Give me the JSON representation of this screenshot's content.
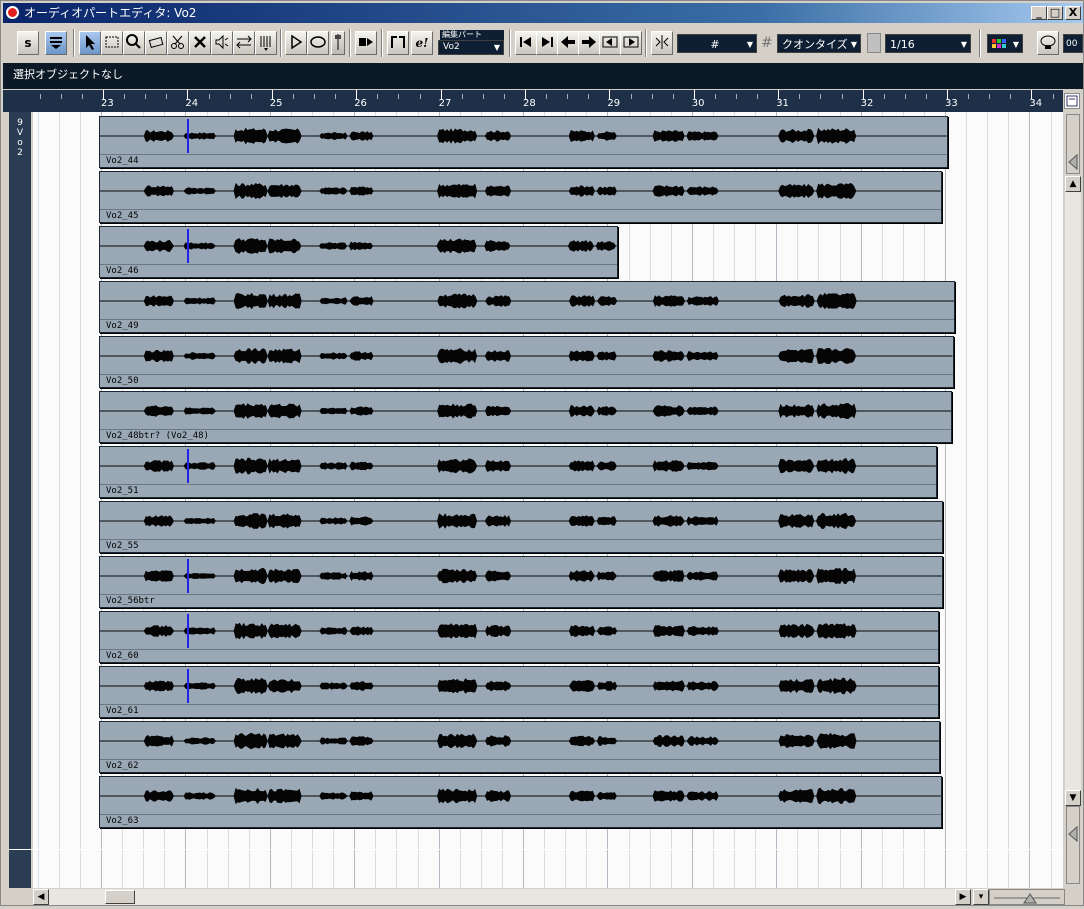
{
  "window": {
    "title": "オーディオパートエディタ: Vo2",
    "btn_min": "_",
    "btn_max": "□",
    "btn_close": "X"
  },
  "toolbar": {
    "solo": "s",
    "edit_part_label": "編集パート",
    "edit_part_value": "Vo2",
    "snap_grid": "#",
    "quantize_label": "クオンタイズ",
    "quantize_value": "1/16",
    "color_icon": "palette-icon",
    "timecode": "00"
  },
  "info_line": "選択オブジェクトなし",
  "ruler": {
    "bars": [
      "23",
      "24",
      "25",
      "26",
      "27",
      "28",
      "29",
      "30",
      "31",
      "32",
      "33",
      "34"
    ]
  },
  "track": {
    "name_chars": [
      "9",
      "V",
      "o",
      "2"
    ]
  },
  "events": [
    {
      "name": "Vo2_44",
      "end_bar": 33.01,
      "cursor": true
    },
    {
      "name": "Vo2_45",
      "end_bar": 32.94,
      "cursor": false
    },
    {
      "name": "Vo2_46",
      "end_bar": 29.1,
      "cursor": true
    },
    {
      "name": "Vo2_49",
      "end_bar": 33.1,
      "cursor": false
    },
    {
      "name": "Vo2_50",
      "end_bar": 33.08,
      "cursor": false
    },
    {
      "name": "Vo2_48btr? (Vo2_48)",
      "end_bar": 33.06,
      "cursor": false
    },
    {
      "name": "Vo2_51",
      "end_bar": 32.88,
      "cursor": true
    },
    {
      "name": "Vo2_55",
      "end_bar": 32.95,
      "cursor": false
    },
    {
      "name": "Vo2_56btr",
      "end_bar": 32.95,
      "cursor": true
    },
    {
      "name": "Vo2_60",
      "end_bar": 32.91,
      "cursor": true
    },
    {
      "name": "Vo2_61",
      "end_bar": 32.91,
      "cursor": true
    },
    {
      "name": "Vo2_62",
      "end_bar": 32.92,
      "cursor": false
    },
    {
      "name": "Vo2_63",
      "end_bar": 32.94,
      "cursor": false
    }
  ],
  "colors": {
    "title_start": "#0a246a",
    "title_end": "#a6caf0",
    "event_fill": "#9aa8b6",
    "ruler_bg": "#1d3047",
    "cursor": "#2222ee"
  }
}
